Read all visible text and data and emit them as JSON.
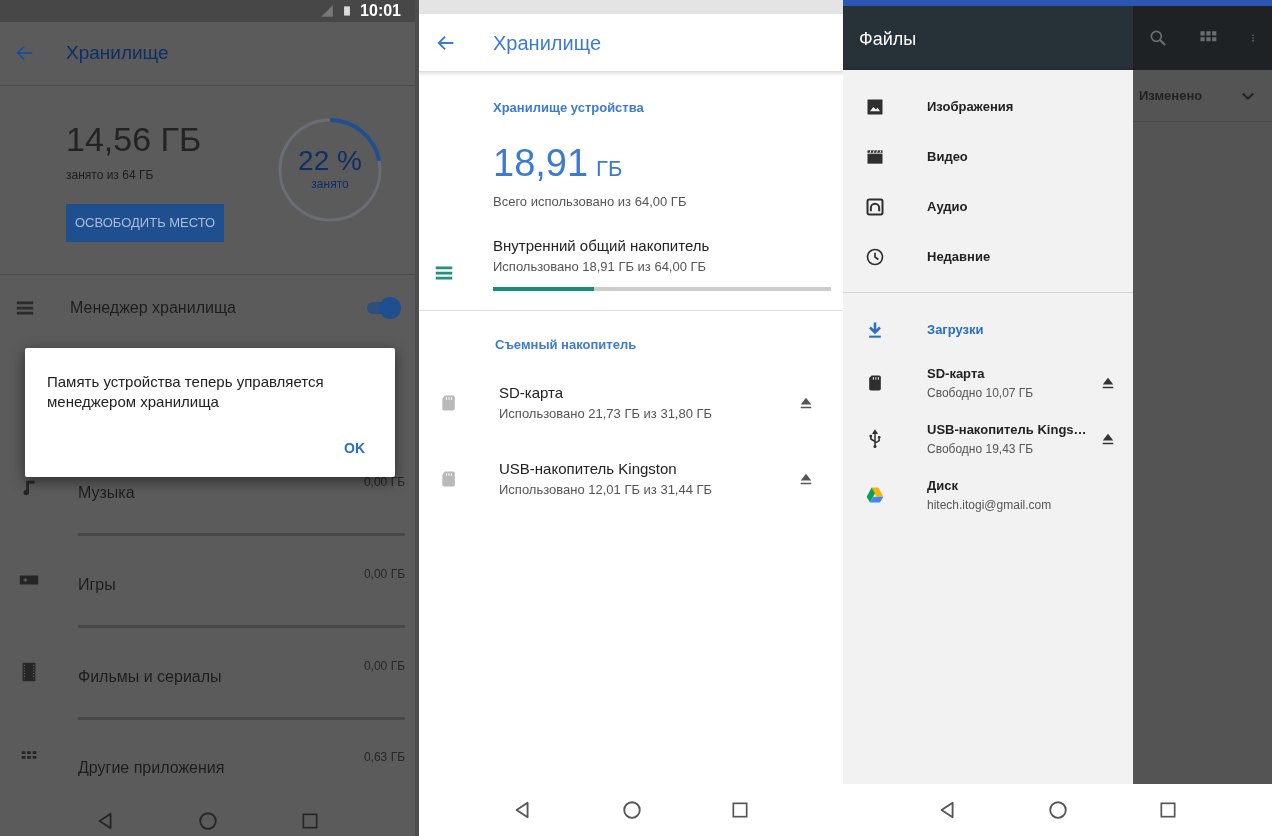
{
  "left_screen": {
    "status_bar": {
      "time": "10:01"
    },
    "title": "Хранилище",
    "used": "14,56 ГБ",
    "used_caption": "занято из 64 ГБ",
    "ring": {
      "percent": "22 %",
      "caption": "занято",
      "level": 0.22
    },
    "free_button": "ОСВОБОДИТЬ МЕСТО",
    "manager": {
      "label": "Менеджер хранилища",
      "on": true
    },
    "categories": [
      {
        "kind": "music",
        "label": "Музыка",
        "size": "0,00 ГБ"
      },
      {
        "kind": "games",
        "label": "Игры",
        "size": "0,00 ГБ"
      },
      {
        "kind": "movies",
        "label": "Фильмы и сериалы",
        "size": "0,00 ГБ"
      },
      {
        "kind": "apps",
        "label": "Другие приложения",
        "size": "0,63 ГБ"
      }
    ],
    "dialog": {
      "message": "Память устройства теперь управляется менеджером хранилища",
      "button": "OK"
    }
  },
  "middle_screen": {
    "title": "Хранилище",
    "device_section": "Хранилище устройства",
    "total": "18,91",
    "total_unit": "ГБ",
    "total_caption": "Всего использовано из 64,00 ГБ",
    "internal": {
      "name": "Внутренний общий накопитель",
      "detail": "Использовано 18,91 ГБ из 64,00 ГБ",
      "level": 0.3
    },
    "removable_section": "Съемный накопитель",
    "removable": [
      {
        "name": "SD-карта",
        "detail": "Использовано 21,73 ГБ из 31,80 ГБ"
      },
      {
        "name": "USB-накопитель Kingston",
        "detail": "Использовано 12,01 ГБ из 31,44 ГБ"
      }
    ]
  },
  "right_screen": {
    "title": "Файлы",
    "sort_label": "Изменено",
    "drawer_groups": [
      [
        {
          "kind": "images",
          "label": "Изображения",
          "selected": false
        },
        {
          "kind": "video",
          "label": "Видео",
          "selected": false
        },
        {
          "kind": "audio",
          "label": "Аудио",
          "selected": false
        },
        {
          "kind": "recent",
          "label": "Недавние",
          "selected": false
        }
      ],
      [
        {
          "kind": "downloads",
          "label": "Загрузки",
          "selected": true
        },
        {
          "kind": "sdcard",
          "label": "SD-карта",
          "subtitle": "Свободно 10,07 ГБ",
          "ejectable": true,
          "selected": false
        },
        {
          "kind": "usb",
          "label": "USB-накопитель Kings…",
          "subtitle": "Свободно 19,43 ГБ",
          "ejectable": true,
          "selected": false
        },
        {
          "kind": "drive",
          "label": "Диск",
          "subtitle": "hitech.itogi@gmail.com",
          "selected": false
        }
      ]
    ]
  }
}
